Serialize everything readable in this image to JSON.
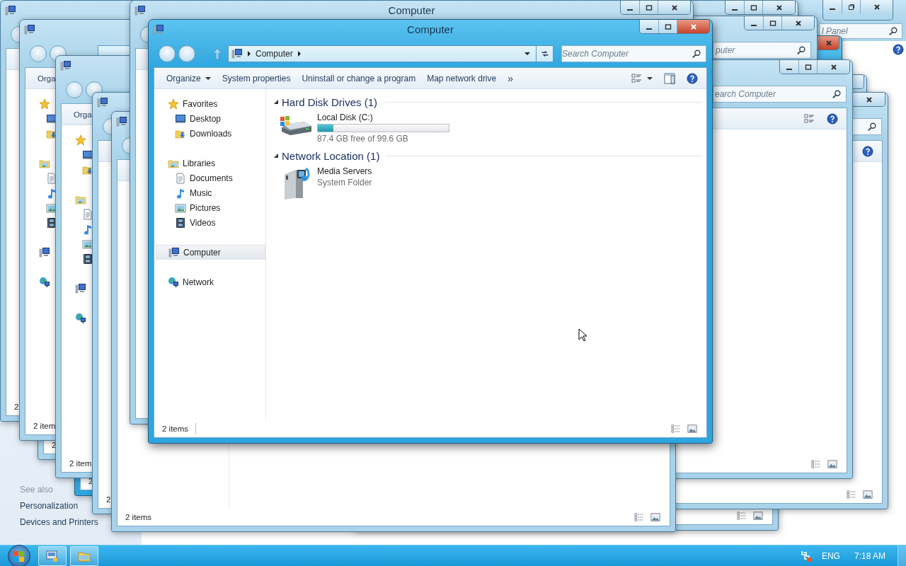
{
  "control_panel": {
    "search": {
      "placeholder": "l Panel"
    },
    "see_also": {
      "heading": "See also",
      "links": [
        "Personalization",
        "Devices and Printers"
      ]
    }
  },
  "background_windows": [
    {
      "kind": "explorer"
    },
    {
      "kind": "explorer",
      "active": true
    },
    {
      "kind": "explorer",
      "search": {
        "placeholder": "puter"
      }
    },
    {
      "kind": "explorer"
    },
    {
      "kind": "explorer"
    },
    {
      "kind": "explorer"
    },
    {
      "kind": "explorer",
      "search": {
        "placeholder": "earch Computer"
      }
    },
    {
      "kind": "explorer",
      "status": "2"
    },
    {
      "kind": "explorer",
      "active": true,
      "status": "2"
    },
    {
      "kind": "explorer",
      "status": "2"
    },
    {
      "kind": "explorer",
      "organize": "Orga",
      "status": "2 item"
    },
    {
      "kind": "explorer",
      "organize": "Orga",
      "status": "2 item"
    },
    {
      "kind": "explorer",
      "status": "2"
    },
    {
      "kind": "explorer",
      "status": "2 items"
    },
    {
      "kind": "explorer",
      "title": "Computer"
    }
  ],
  "window": {
    "title": "Computer",
    "address": {
      "crumbs": [
        "Computer"
      ]
    },
    "search": {
      "placeholder": "Search Computer"
    },
    "toolbar": [
      {
        "label": "Organize",
        "dropdown": true
      },
      {
        "label": "System properties",
        "dropdown": false
      },
      {
        "label": "Uninstall or change a program",
        "dropdown": false
      },
      {
        "label": "Map network drive",
        "dropdown": false
      }
    ],
    "toolbar_overflow": "»",
    "sidebar": [
      {
        "label": "Favorites",
        "selected": false,
        "children": [
          {
            "label": "Desktop",
            "selected": false
          },
          {
            "label": "Downloads",
            "selected": false
          }
        ]
      },
      {
        "label": "Libraries",
        "selected": false,
        "children": [
          {
            "label": "Documents",
            "selected": false
          },
          {
            "label": "Music",
            "selected": false
          },
          {
            "label": "Pictures",
            "selected": false
          },
          {
            "label": "Videos",
            "selected": false
          }
        ]
      },
      {
        "label": "Computer",
        "selected": true
      },
      {
        "label": "Network",
        "selected": false
      }
    ],
    "groups": [
      {
        "heading": "Hard Disk Drives (1)",
        "expanded": true,
        "items": [
          {
            "kind": "drive",
            "name": "Local Disk (C:)",
            "level": 0.12,
            "detail": "87.4 GB free of 99.6 GB"
          }
        ]
      },
      {
        "heading": "Network Location (1)",
        "expanded": true,
        "items": [
          {
            "kind": "system_folder",
            "name": "Media Servers",
            "detail": "System Folder"
          }
        ]
      }
    ],
    "status_bar": {
      "count": "2 items"
    }
  },
  "taskbar": {
    "language": "ENG",
    "clock": "7:18 AM"
  }
}
